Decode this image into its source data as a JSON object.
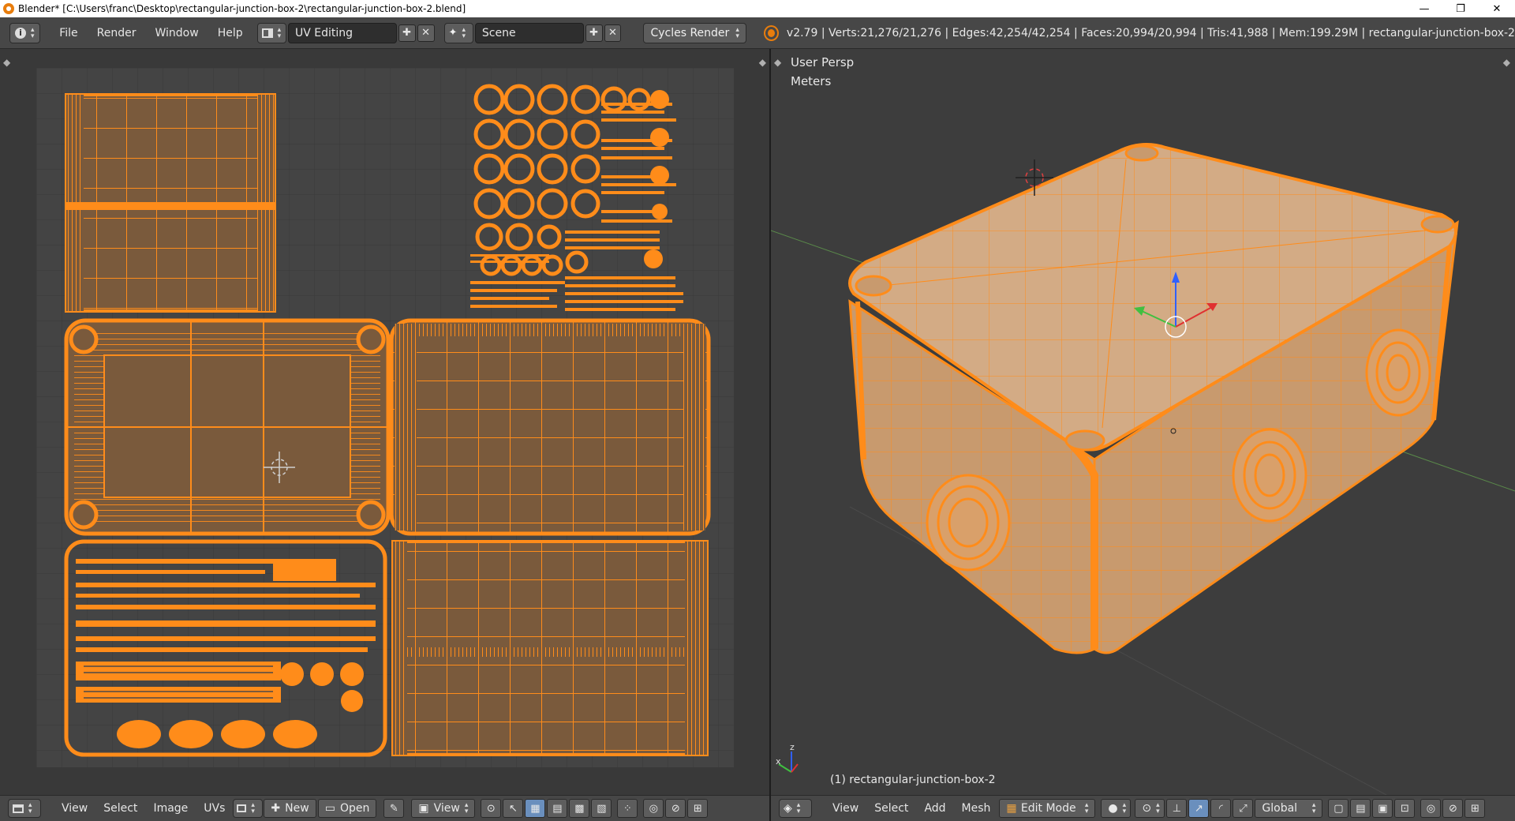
{
  "window": {
    "title": "Blender* [C:\\Users\\franc\\Desktop\\rectangular-junction-box-2\\rectangular-junction-box-2.blend]",
    "minimize": "—",
    "maximize": "❐",
    "close": "✕"
  },
  "info_header": {
    "editor_type_icon": "info-icon",
    "menus": [
      "File",
      "Render",
      "Window",
      "Help"
    ],
    "layout": "UV Editing",
    "scene": "Scene",
    "render_engine": "Cycles Render",
    "stats": "v2.79 | Verts:21,276/21,276 | Edges:42,254/42,254 | Faces:20,994/20,994 | Tris:41,988 | Mem:199.29M | rectangular-junction-box-2"
  },
  "viewport3d": {
    "view_name": "User Persp",
    "units": "Meters",
    "object_label": "(1) rectangular-junction-box-2",
    "axis_x_label": "x",
    "axis_z_label": "z"
  },
  "uv_footer": {
    "menus": [
      "View",
      "Select",
      "Image",
      "UVs"
    ],
    "new_label": "New",
    "open_label": "Open",
    "view_label": "View"
  },
  "v3d_footer": {
    "menus": [
      "View",
      "Select",
      "Add",
      "Mesh"
    ],
    "mode": "Edit Mode",
    "orientation": "Global"
  },
  "colors": {
    "selection_orange": "#ff8c1a",
    "uv_fill": "#7a5a3c",
    "mesh_fill": "#c89a6e",
    "background": "#393939"
  }
}
